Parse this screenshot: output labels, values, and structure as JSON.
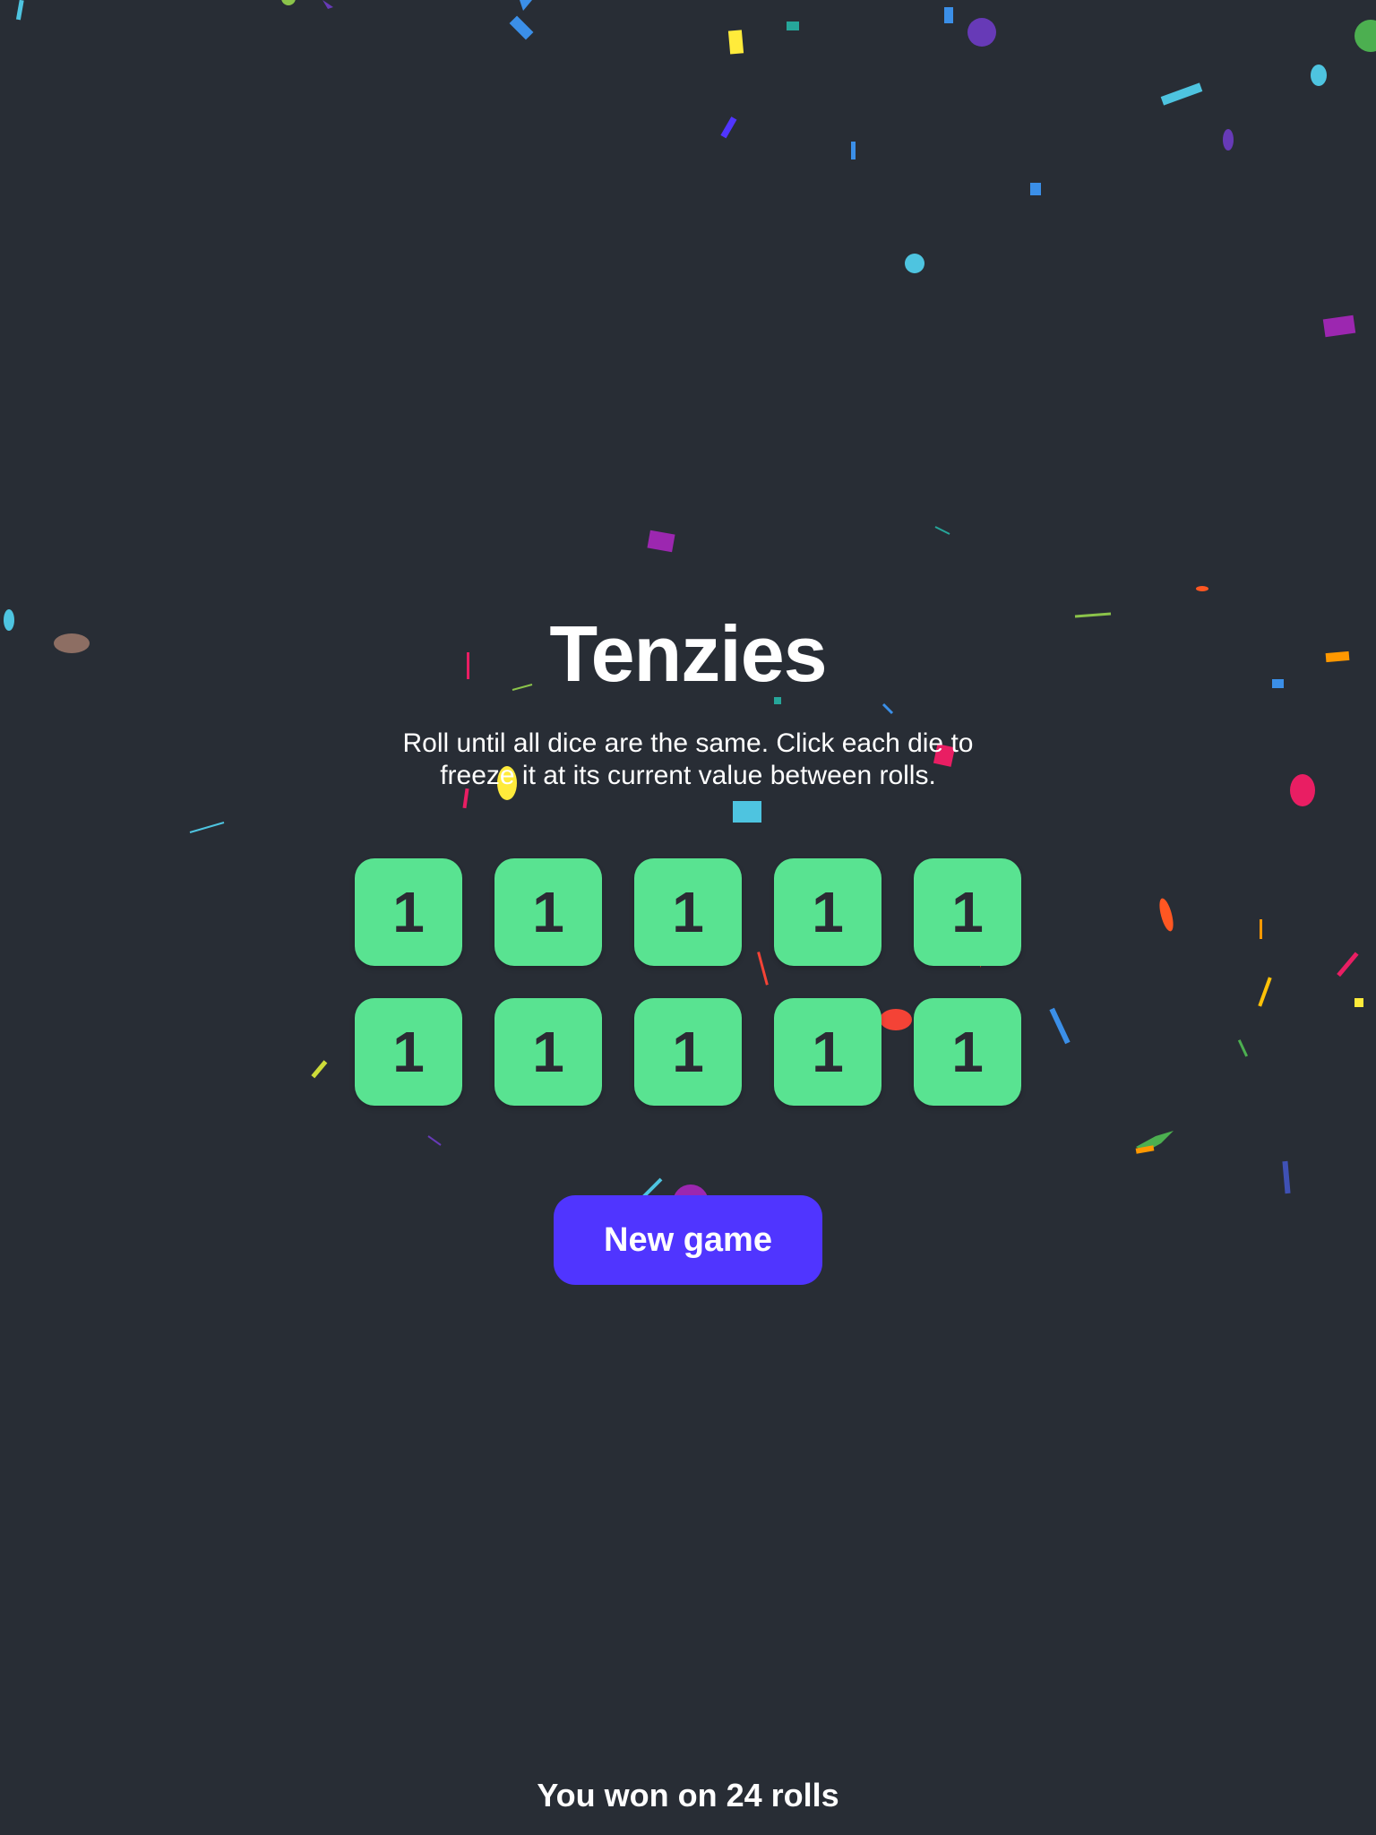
{
  "game": {
    "title": "Tenzies",
    "instructions": "Roll until all dice are the same. Click each die to freeze it at its current value between rolls.",
    "dice": [
      "1",
      "1",
      "1",
      "1",
      "1",
      "1",
      "1",
      "1",
      "1",
      "1"
    ],
    "new_game_label": "New game",
    "result_text": "You won on 24 rolls"
  },
  "colors": {
    "background": "#282d35",
    "die_held": "#59e391",
    "button": "#5035ff",
    "text": "#ffffff"
  }
}
